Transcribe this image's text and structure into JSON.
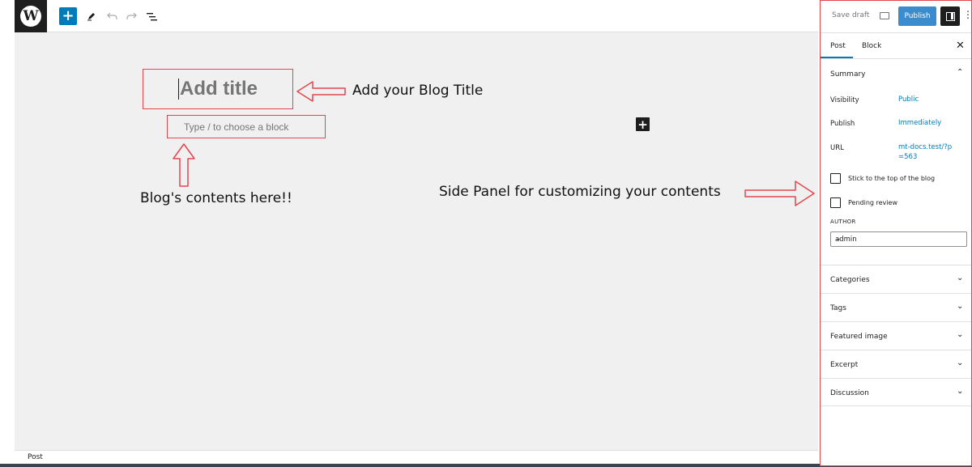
{
  "toolbar": {
    "logo_letter": "W",
    "add_label": "+"
  },
  "editor": {
    "title_placeholder": "Add title",
    "block_placeholder": "Type / to choose a block",
    "inline_add": "+"
  },
  "annotations": {
    "title_note": "Add your Blog Title",
    "content_note": "Blog's contents here!!",
    "panel_note": "Side Panel for customizing your contents"
  },
  "statusbar": {
    "breadcrumb": "Post"
  },
  "sidebar": {
    "save_draft": "Save draft",
    "publish": "Publish",
    "tabs": {
      "post": "Post",
      "block": "Block"
    },
    "summary": {
      "title": "Summary",
      "visibility_label": "Visibility",
      "visibility_value": "Public",
      "publish_label": "Publish",
      "publish_value": "Immediately",
      "url_label": "URL",
      "url_value": "mt-docs.test/?p=563",
      "sticky_label": "Stick to the top of the blog",
      "pending_label": "Pending review",
      "author_label": "AUTHOR",
      "author_value": "admin"
    },
    "panels": [
      "Categories",
      "Tags",
      "Featured image",
      "Excerpt",
      "Discussion"
    ]
  },
  "colors": {
    "accent": "#007cba",
    "annotation": "#e0474c",
    "canvas": "#f0f0f0"
  }
}
